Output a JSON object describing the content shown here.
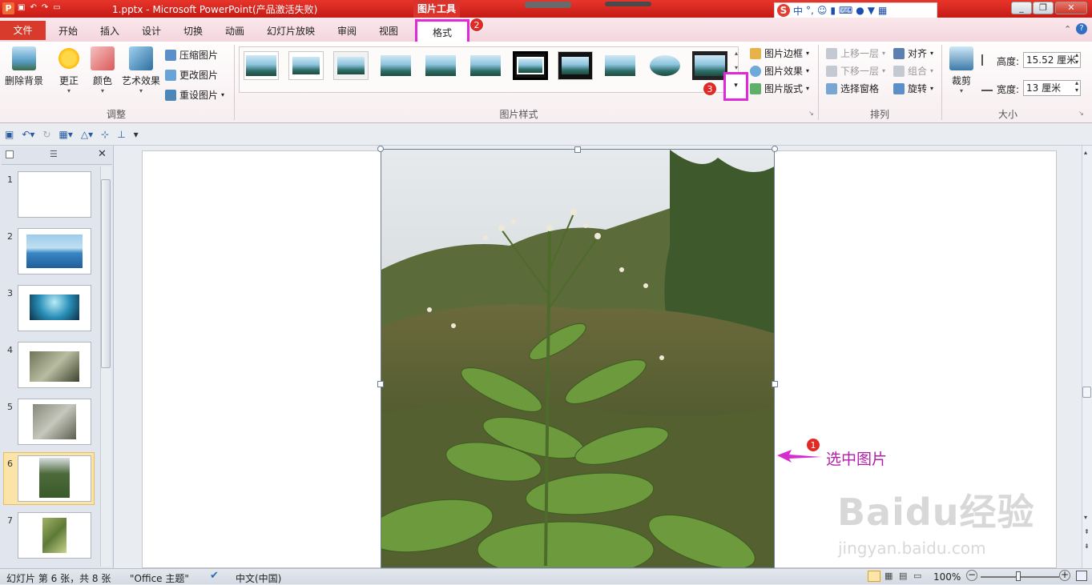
{
  "window": {
    "title": "1.pptx - Microsoft PowerPoint(产品激活失败)",
    "context_tab_header": "图片工具",
    "controls": [
      "minimize",
      "restore",
      "close"
    ]
  },
  "ime": {
    "brand": "S",
    "items": [
      "中",
      "°,",
      "☺",
      "🎤",
      "⌨",
      "👤",
      "👕",
      "▦"
    ]
  },
  "tabs": {
    "file": "文件",
    "items": [
      "开始",
      "插入",
      "设计",
      "切换",
      "动画",
      "幻灯片放映",
      "审阅",
      "视图"
    ],
    "format": "格式",
    "help_icons": [
      "chevron-up-icon",
      "help-icon"
    ]
  },
  "ribbon": {
    "adjust": {
      "remove_bg": "删除背景",
      "corrections": "更正",
      "color": "颜色",
      "artistic": "艺术效果",
      "compress": "压缩图片",
      "change": "更改图片",
      "reset": "重设图片",
      "group_label": "调整"
    },
    "styles": {
      "group_label": "图片样式",
      "border": "图片边框",
      "effects": "图片效果",
      "layout": "图片版式"
    },
    "arrange": {
      "bring_forward": "上移一层",
      "send_backward": "下移一层",
      "selection_pane": "选择窗格",
      "align": "对齐",
      "group": "组合",
      "rotate": "旋转",
      "group_label": "排列"
    },
    "size": {
      "crop": "裁剪",
      "height_label": "高度:",
      "height_value": "15.52 厘米",
      "width_label": "宽度:",
      "width_value": "13 厘米",
      "group_label": "大小"
    }
  },
  "badges": {
    "b1": "1",
    "b2": "2",
    "b3": "3"
  },
  "slides": {
    "numbers": [
      "1",
      "2",
      "3",
      "4",
      "5",
      "6",
      "7"
    ],
    "selected": 6
  },
  "annotation": {
    "text": "选中图片"
  },
  "watermark": {
    "main": "Baidu经验",
    "sub": "jingyan.baidu.com"
  },
  "status": {
    "slide_info": "幻灯片 第 6 张，共 8 张",
    "theme": "\"Office 主题\"",
    "language": "中文(中国)",
    "zoom": "100%"
  },
  "colors": {
    "accent": "#e02ad8",
    "title_red": "#d83b2c"
  }
}
